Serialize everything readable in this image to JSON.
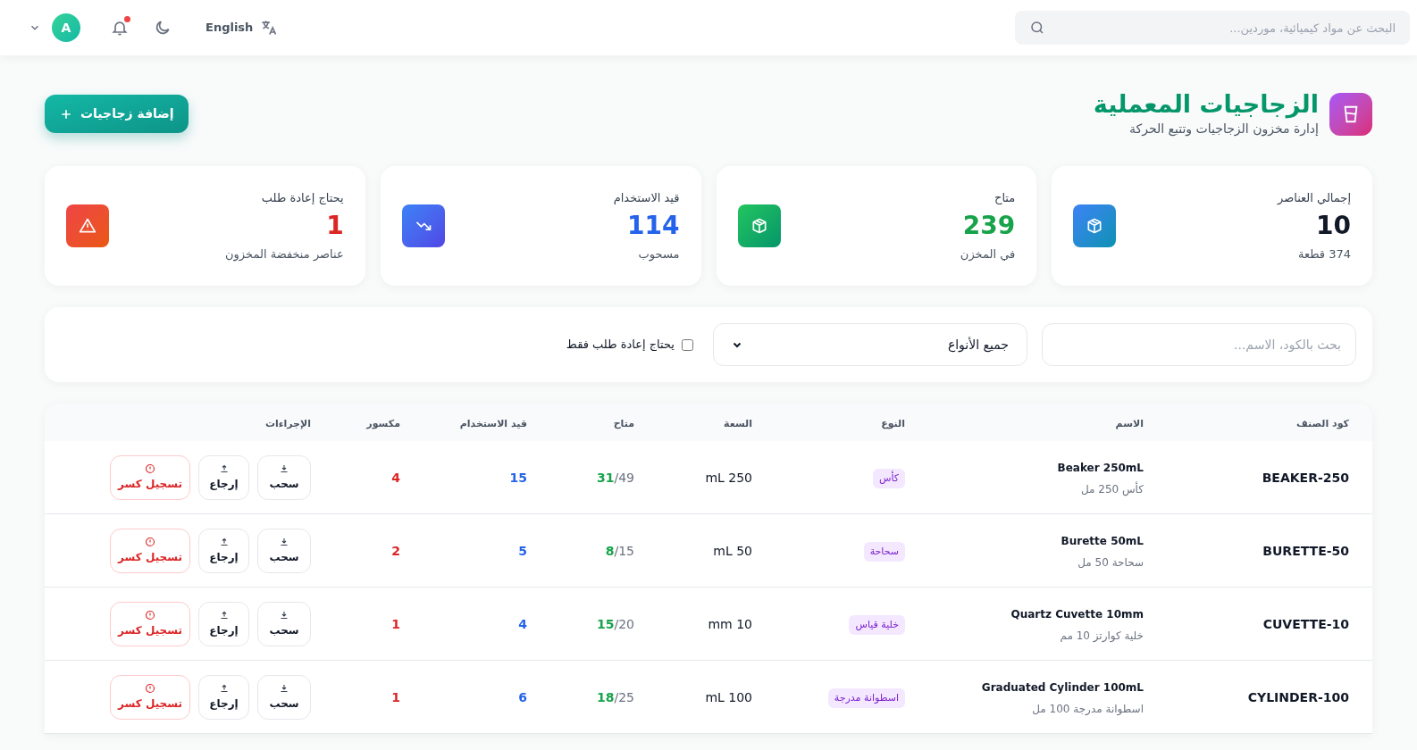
{
  "topbar": {
    "search": {
      "placeholder": "البحث عن مواد كيميائية، موردين..."
    },
    "language": "English",
    "notifications": {
      "unread": true
    },
    "avatar": "A"
  },
  "page": {
    "title": "الزجاجيات المعملية",
    "subtitle": "إدارة مخزون الزجاجيات وتتبع الحركة",
    "add_button": "إضافة زجاجيات"
  },
  "stats": [
    {
      "kind": "box",
      "label": "إجمالي العناصر",
      "value": "10",
      "note": "374 قطعة",
      "color": "#111827"
    },
    {
      "kind": "box-green",
      "label": "متاح",
      "value": "239",
      "note": "في المخزن",
      "color": "#16a34a"
    },
    {
      "kind": "trend-down",
      "label": "قيد الاستخدام",
      "value": "114",
      "note": "مسحوب",
      "color": "#2563eb"
    },
    {
      "kind": "warning",
      "label": "يحتاج إعادة طلب",
      "value": "1",
      "note": "عناصر منخفضة المخزون",
      "color": "#dc2626"
    }
  ],
  "filters": {
    "search": {
      "placeholder": "بحث بالكود، الاسم..."
    },
    "type_select": {
      "value": "جميع الأنواع"
    },
    "reorder_only": {
      "label": "يحتاج إعادة طلب فقط",
      "checked": false
    }
  },
  "table": {
    "columns": [
      "كود الصنف",
      "الاسم",
      "النوع",
      "السعة",
      "متاح",
      "قيد الاستخدام",
      "مكسور",
      "الإجراءات"
    ],
    "rows": [
      {
        "code": "BEAKER-250",
        "name": "Beaker 250mL",
        "name_ar": "كأس 250 مل",
        "type": "كأس",
        "capacity": "250 mL",
        "available": "31",
        "total": "/49",
        "in_use": "15",
        "broken": "4",
        "actions": [
          {
            "kind": "withdraw",
            "label": "سحب"
          },
          {
            "kind": "return",
            "label": "إرجاع"
          },
          {
            "kind": "break",
            "label": "تسجيل كسر"
          }
        ]
      },
      {
        "code": "BURETTE-50",
        "name": "Burette 50mL",
        "name_ar": "سحاحة 50 مل",
        "type": "سحاحة",
        "capacity": "50 mL",
        "available": "8",
        "total": "/15",
        "in_use": "5",
        "broken": "2",
        "actions": [
          {
            "kind": "withdraw",
            "label": "سحب"
          },
          {
            "kind": "return",
            "label": "إرجاع"
          },
          {
            "kind": "break",
            "label": "تسجيل كسر"
          }
        ]
      },
      {
        "code": "CUVETTE-10",
        "name": "Quartz Cuvette 10mm",
        "name_ar": "خلية كوارتز 10 مم",
        "type": "خلية قياس",
        "capacity": "10 mm",
        "available": "15",
        "total": "/20",
        "in_use": "4",
        "broken": "1",
        "actions": [
          {
            "kind": "withdraw",
            "label": "سحب"
          },
          {
            "kind": "return",
            "label": "إرجاع"
          },
          {
            "kind": "break",
            "label": "تسجيل كسر"
          }
        ]
      },
      {
        "code": "CYLINDER-100",
        "name": "Graduated Cylinder 100mL",
        "name_ar": "اسطوانة مدرجة 100 مل",
        "type": "اسطوانة مدرجة",
        "capacity": "100 mL",
        "available": "18",
        "total": "/25",
        "in_use": "6",
        "broken": "1",
        "actions": [
          {
            "kind": "withdraw",
            "label": "سحب"
          },
          {
            "kind": "return",
            "label": "إرجاع"
          },
          {
            "kind": "break",
            "label": "تسجيل كسر"
          }
        ]
      }
    ]
  }
}
